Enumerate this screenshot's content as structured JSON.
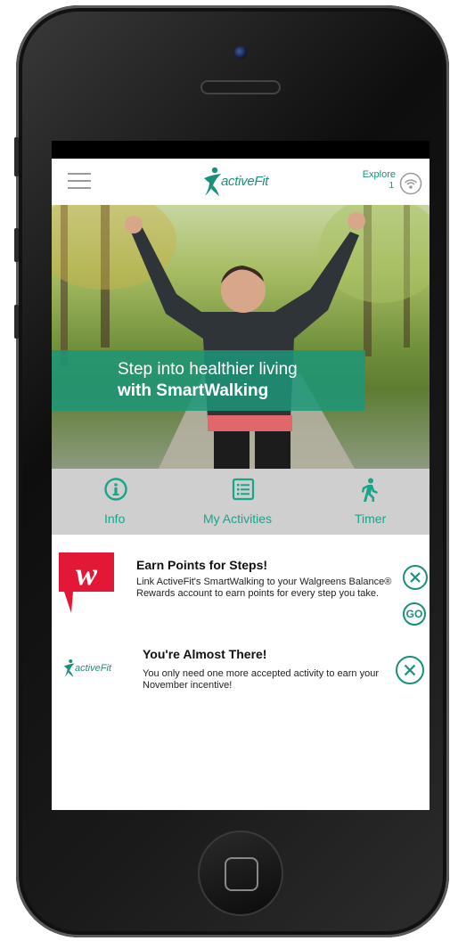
{
  "header": {
    "logo_text": "activeFit",
    "explore_label": "Explore",
    "explore_count": "1"
  },
  "hero": {
    "line1": "Step into healthier living",
    "line2": "with SmartWalking"
  },
  "tabs": [
    {
      "label": "Info",
      "icon": "info-icon"
    },
    {
      "label": "My Activities",
      "icon": "list-icon"
    },
    {
      "label": "Timer",
      "icon": "walking-person-icon"
    }
  ],
  "cards": [
    {
      "title": "Earn Points for Steps!",
      "body": "Link ActiveFit's SmartWalking to your Walgreens Balance® Rewards account to earn points for every step you take.",
      "logo": "walgreens-logo",
      "go_label": "GO"
    },
    {
      "title": "You're Almost There!",
      "body": "You only need one more accepted activity to earn your November incentive!",
      "logo_text": "activeFit"
    }
  ],
  "colors": {
    "accent": "#1a8f79",
    "tab_label": "#19a58a",
    "tabbar_bg": "#cfcfcf",
    "walgreens_red": "#e31837"
  }
}
